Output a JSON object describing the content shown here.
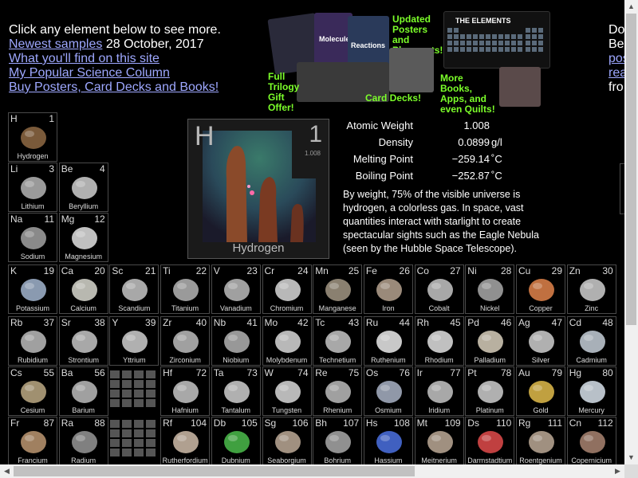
{
  "intro": {
    "line1": "Click any element below to see more.",
    "newest_link": "Newest samples",
    "newest_date": "28 October, 2017",
    "what_link": "What you'll find on this site",
    "column_link": "My Popular Science Column",
    "buy_link": "Buy Posters, Card Decks and Books!"
  },
  "right_cut": {
    "l1": "Do",
    "l2": "Be",
    "l3": "pos",
    "l4": "rea",
    "l5": "fro"
  },
  "promo": {
    "trilogy": "Full Trilogy Gift Offer!",
    "updated": "Updated Posters and Placemats!",
    "card_decks": "Card Decks!",
    "more_books": "More Books, Apps, and even Quilts!",
    "the_elements": "THE ELEMENTS",
    "molecules": "Molecules",
    "reactions": "Reactions"
  },
  "featured": {
    "symbol": "H",
    "number": "1",
    "weight_small": "1.008",
    "name": "Hydrogen",
    "props": [
      {
        "label": "Atomic Weight",
        "value": "1.008",
        "unit": ""
      },
      {
        "label": "Density",
        "value": "0.0899",
        "unit": "g/l"
      },
      {
        "label": "Melting Point",
        "value": "−259.14",
        "unit": "˚C"
      },
      {
        "label": "Boiling Point",
        "value": "−252.87",
        "unit": "˚C"
      }
    ],
    "description": "By weight, 75% of the visible universe is hydrogen, a colorless gas. In space, vast quantities interact with starlight to create spectacular sights such as the Eagle Nebula (seen by the Hubble Space Telescope)."
  },
  "elements": [
    {
      "s": "H",
      "n": "1",
      "name": "Hydrogen",
      "col": 0,
      "row": 0,
      "color": "#7a5a3a"
    },
    {
      "s": "Li",
      "n": "3",
      "name": "Lithium",
      "col": 0,
      "row": 1,
      "color": "#9a9a9a"
    },
    {
      "s": "Be",
      "n": "4",
      "name": "Beryllium",
      "col": 1,
      "row": 1,
      "color": "#b0b0b0"
    },
    {
      "s": "Na",
      "n": "11",
      "name": "Sodium",
      "col": 0,
      "row": 2,
      "color": "#8a8a8a"
    },
    {
      "s": "Mg",
      "n": "12",
      "name": "Magnesium",
      "col": 1,
      "row": 2,
      "color": "#c0c0c0"
    },
    {
      "s": "K",
      "n": "19",
      "name": "Potassium",
      "col": 0,
      "row": 3,
      "color": "#8a9ab0"
    },
    {
      "s": "Ca",
      "n": "20",
      "name": "Calcium",
      "col": 1,
      "row": 3,
      "color": "#b8b8b0"
    },
    {
      "s": "Sc",
      "n": "21",
      "name": "Scandium",
      "col": 2,
      "row": 3,
      "color": "#a8a8a8"
    },
    {
      "s": "Ti",
      "n": "22",
      "name": "Titanium",
      "col": 3,
      "row": 3,
      "color": "#9a9a9a"
    },
    {
      "s": "V",
      "n": "23",
      "name": "Vanadium",
      "col": 4,
      "row": 3,
      "color": "#a0a0a0"
    },
    {
      "s": "Cr",
      "n": "24",
      "name": "Chromium",
      "col": 5,
      "row": 3,
      "color": "#b8b8b8"
    },
    {
      "s": "Mn",
      "n": "25",
      "name": "Manganese",
      "col": 6,
      "row": 3,
      "color": "#8a8070"
    },
    {
      "s": "Fe",
      "n": "26",
      "name": "Iron",
      "col": 7,
      "row": 3,
      "color": "#9a8a7a"
    },
    {
      "s": "Co",
      "n": "27",
      "name": "Cobalt",
      "col": 8,
      "row": 3,
      "color": "#a8a8a8"
    },
    {
      "s": "Ni",
      "n": "28",
      "name": "Nickel",
      "col": 9,
      "row": 3,
      "color": "#909090"
    },
    {
      "s": "Cu",
      "n": "29",
      "name": "Copper",
      "col": 10,
      "row": 3,
      "color": "#c07040"
    },
    {
      "s": "Zn",
      "n": "30",
      "name": "Zinc",
      "col": 11,
      "row": 3,
      "color": "#b0b0b0"
    },
    {
      "s": "Rb",
      "n": "37",
      "name": "Rubidium",
      "col": 0,
      "row": 4,
      "color": "#a0a0a0"
    },
    {
      "s": "Sr",
      "n": "38",
      "name": "Strontium",
      "col": 1,
      "row": 4,
      "color": "#a8a8a8"
    },
    {
      "s": "Y",
      "n": "39",
      "name": "Yttrium",
      "col": 2,
      "row": 4,
      "color": "#b0b0b0"
    },
    {
      "s": "Zr",
      "n": "40",
      "name": "Zirconium",
      "col": 3,
      "row": 4,
      "color": "#a0a0a0"
    },
    {
      "s": "Nb",
      "n": "41",
      "name": "Niobium",
      "col": 4,
      "row": 4,
      "color": "#989898"
    },
    {
      "s": "Mo",
      "n": "42",
      "name": "Molybdenum",
      "col": 5,
      "row": 4,
      "color": "#b8b8b8"
    },
    {
      "s": "Tc",
      "n": "43",
      "name": "Technetium",
      "col": 6,
      "row": 4,
      "color": "#a8a8a8"
    },
    {
      "s": "Ru",
      "n": "44",
      "name": "Ruthenium",
      "col": 7,
      "row": 4,
      "color": "#c8c8c8"
    },
    {
      "s": "Rh",
      "n": "45",
      "name": "Rhodium",
      "col": 8,
      "row": 4,
      "color": "#c0c0c0"
    },
    {
      "s": "Pd",
      "n": "46",
      "name": "Palladium",
      "col": 9,
      "row": 4,
      "color": "#b8b0a0"
    },
    {
      "s": "Ag",
      "n": "47",
      "name": "Silver",
      "col": 10,
      "row": 4,
      "color": "#b0b0b0"
    },
    {
      "s": "Cd",
      "n": "48",
      "name": "Cadmium",
      "col": 11,
      "row": 4,
      "color": "#a8b0b8"
    },
    {
      "s": "Cs",
      "n": "55",
      "name": "Cesium",
      "col": 0,
      "row": 5,
      "color": "#a09070"
    },
    {
      "s": "Ba",
      "n": "56",
      "name": "Barium",
      "col": 1,
      "row": 5,
      "color": "#a0a0a0"
    },
    {
      "s": "Hf",
      "n": "72",
      "name": "Hafnium",
      "col": 3,
      "row": 5,
      "color": "#a8a8a8"
    },
    {
      "s": "Ta",
      "n": "73",
      "name": "Tantalum",
      "col": 4,
      "row": 5,
      "color": "#b0b0b0"
    },
    {
      "s": "W",
      "n": "74",
      "name": "Tungsten",
      "col": 5,
      "row": 5,
      "color": "#b8b8b8"
    },
    {
      "s": "Re",
      "n": "75",
      "name": "Rhenium",
      "col": 6,
      "row": 5,
      "color": "#a0a0a0"
    },
    {
      "s": "Os",
      "n": "76",
      "name": "Osmium",
      "col": 7,
      "row": 5,
      "color": "#9098a8"
    },
    {
      "s": "Ir",
      "n": "77",
      "name": "Iridium",
      "col": 8,
      "row": 5,
      "color": "#a8a8a8"
    },
    {
      "s": "Pt",
      "n": "78",
      "name": "Platinum",
      "col": 9,
      "row": 5,
      "color": "#b0b0b0"
    },
    {
      "s": "Au",
      "n": "79",
      "name": "Gold",
      "col": 10,
      "row": 5,
      "color": "#c0a040"
    },
    {
      "s": "Hg",
      "n": "80",
      "name": "Mercury",
      "col": 11,
      "row": 5,
      "color": "#b8c0c8"
    },
    {
      "s": "Fr",
      "n": "87",
      "name": "Francium",
      "col": 0,
      "row": 6,
      "color": "#a08060"
    },
    {
      "s": "Ra",
      "n": "88",
      "name": "Radium",
      "col": 1,
      "row": 6,
      "color": "#808080"
    },
    {
      "s": "Rf",
      "n": "104",
      "name": "Rutherfordium",
      "col": 3,
      "row": 6,
      "color": "#b0a090"
    },
    {
      "s": "Db",
      "n": "105",
      "name": "Dubnium",
      "col": 4,
      "row": 6,
      "color": "#40a040"
    },
    {
      "s": "Sg",
      "n": "106",
      "name": "Seaborgium",
      "col": 5,
      "row": 6,
      "color": "#a09080"
    },
    {
      "s": "Bh",
      "n": "107",
      "name": "Bohrium",
      "col": 6,
      "row": 6,
      "color": "#909090"
    },
    {
      "s": "Hs",
      "n": "108",
      "name": "Hassium",
      "col": 7,
      "row": 6,
      "color": "#4060c0"
    },
    {
      "s": "Mt",
      "n": "109",
      "name": "Meitnerium",
      "col": 8,
      "row": 6,
      "color": "#a09080"
    },
    {
      "s": "Ds",
      "n": "110",
      "name": "Darmstadtium",
      "col": 9,
      "row": 6,
      "color": "#c04040"
    },
    {
      "s": "Rg",
      "n": "111",
      "name": "Roentgenium",
      "col": 10,
      "row": 6,
      "color": "#a09080"
    },
    {
      "s": "Cn",
      "n": "112",
      "name": "Copernicium",
      "col": 11,
      "row": 6,
      "color": "#907060"
    }
  ],
  "scroll": {
    "up": "▲",
    "down": "▼",
    "left": "◀",
    "right": "▶"
  }
}
